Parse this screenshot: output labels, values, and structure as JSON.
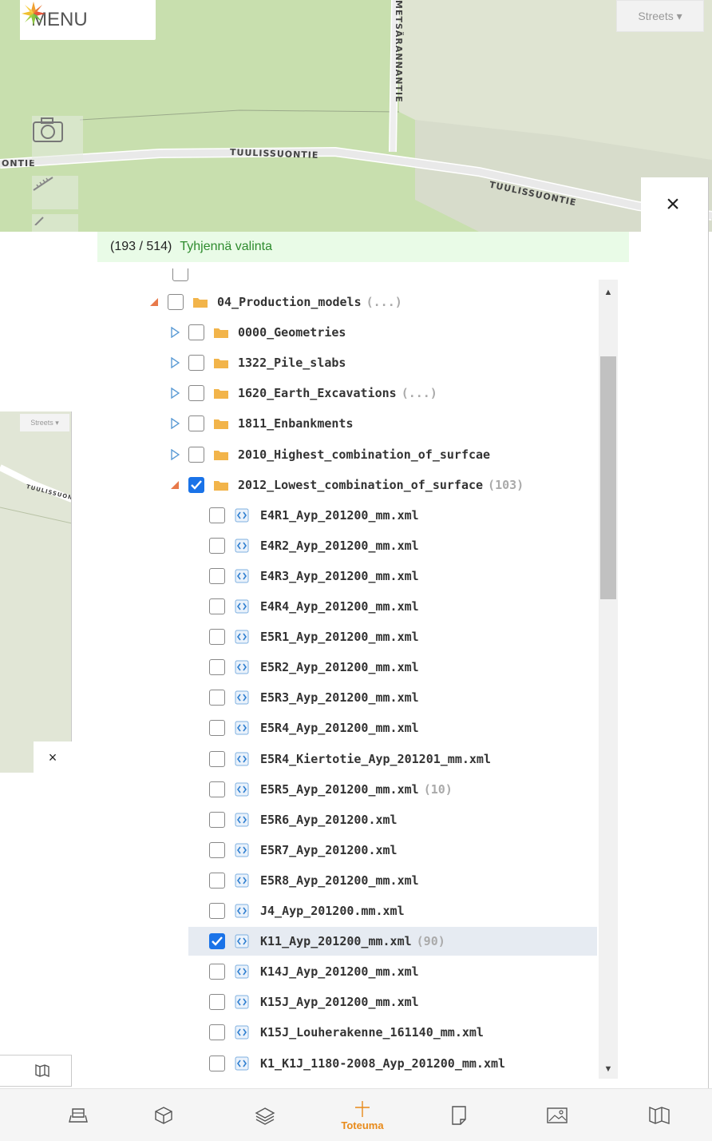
{
  "map": {
    "menu_label": "MENU",
    "basemap_label": "Streets ▾",
    "roads": {
      "vertical": "METSÄRANNANTIE",
      "main_1": "TUULISSUONTIE",
      "main_2": "TUULISSUONTIE",
      "left_fragment": "ONTIE"
    }
  },
  "ghost": {
    "basemap_label": "Streets ▾",
    "road_fragment": "TUULISSUONT",
    "close": "×"
  },
  "panel": {
    "close": "×",
    "selection_count": "(193 / 514)",
    "clear_selection": "Tyhjennä valinta"
  },
  "tree": [
    {
      "type": "folder",
      "depth": 0,
      "expanded": true,
      "checked": false,
      "label": "04_Production_models",
      "count": "(...)"
    },
    {
      "type": "folder",
      "depth": 1,
      "expanded": false,
      "checked": false,
      "label": "0000_Geometries",
      "count": ""
    },
    {
      "type": "folder",
      "depth": 1,
      "expanded": false,
      "checked": false,
      "label": "1322_Pile_slabs",
      "count": ""
    },
    {
      "type": "folder",
      "depth": 1,
      "expanded": false,
      "checked": false,
      "label": "1620_Earth_Excavations",
      "count": "(...)"
    },
    {
      "type": "folder",
      "depth": 1,
      "expanded": false,
      "checked": false,
      "label": "1811_Enbankments",
      "count": ""
    },
    {
      "type": "folder",
      "depth": 1,
      "expanded": false,
      "checked": false,
      "label": "2010_Highest_combination_of_surfcae",
      "count": ""
    },
    {
      "type": "folder",
      "depth": 1,
      "expanded": true,
      "checked": true,
      "label": "2012_Lowest_combination_of_surface",
      "count": "(103)"
    },
    {
      "type": "file",
      "depth": 2,
      "checked": false,
      "label": "E4R1_Ayp_201200_mm.xml",
      "count": ""
    },
    {
      "type": "file",
      "depth": 2,
      "checked": false,
      "label": "E4R2_Ayp_201200_mm.xml",
      "count": ""
    },
    {
      "type": "file",
      "depth": 2,
      "checked": false,
      "label": "E4R3_Ayp_201200_mm.xml",
      "count": ""
    },
    {
      "type": "file",
      "depth": 2,
      "checked": false,
      "label": "E4R4_Ayp_201200_mm.xml",
      "count": ""
    },
    {
      "type": "file",
      "depth": 2,
      "checked": false,
      "label": "E5R1_Ayp_201200_mm.xml",
      "count": ""
    },
    {
      "type": "file",
      "depth": 2,
      "checked": false,
      "label": "E5R2_Ayp_201200_mm.xml",
      "count": ""
    },
    {
      "type": "file",
      "depth": 2,
      "checked": false,
      "label": "E5R3_Ayp_201200_mm.xml",
      "count": ""
    },
    {
      "type": "file",
      "depth": 2,
      "checked": false,
      "label": "E5R4_Ayp_201200_mm.xml",
      "count": ""
    },
    {
      "type": "file",
      "depth": 2,
      "checked": false,
      "label": "E5R4_Kiertotie_Ayp_201201_mm.xml",
      "count": ""
    },
    {
      "type": "file",
      "depth": 2,
      "checked": false,
      "label": "E5R5_Ayp_201200_mm.xml",
      "count": "(10)"
    },
    {
      "type": "file",
      "depth": 2,
      "checked": false,
      "label": "E5R6_Ayp_201200.xml",
      "count": ""
    },
    {
      "type": "file",
      "depth": 2,
      "checked": false,
      "label": "E5R7_Ayp_201200.xml",
      "count": ""
    },
    {
      "type": "file",
      "depth": 2,
      "checked": false,
      "label": "E5R8_Ayp_201200_mm.xml",
      "count": ""
    },
    {
      "type": "file",
      "depth": 2,
      "checked": false,
      "label": "J4_Ayp_201200.mm.xml",
      "count": ""
    },
    {
      "type": "file",
      "depth": 2,
      "checked": true,
      "highlight": true,
      "label": "K11_Ayp_201200_mm.xml",
      "count": "(90)"
    },
    {
      "type": "file",
      "depth": 2,
      "checked": false,
      "label": "K14J_Ayp_201200_mm.xml",
      "count": ""
    },
    {
      "type": "file",
      "depth": 2,
      "checked": false,
      "label": "K15J_Ayp_201200_mm.xml",
      "count": ""
    },
    {
      "type": "file",
      "depth": 2,
      "checked": false,
      "label": "K15J_Louherakenne_161140_mm.xml",
      "count": ""
    },
    {
      "type": "file",
      "depth": 2,
      "checked": false,
      "label": "K1_K1J_1180-2008_Ayp_201200_mm.xml",
      "count": ""
    }
  ],
  "bottom_nav": [
    {
      "icon": "layers-map-icon",
      "label": ""
    },
    {
      "icon": "cube-icon",
      "label": ""
    },
    {
      "icon": "stack-layers-icon",
      "label": ""
    },
    {
      "icon": "plus-cross-icon",
      "label": "Toteuma",
      "active": true
    },
    {
      "icon": "note-icon",
      "label": ""
    },
    {
      "icon": "image-icon",
      "label": ""
    },
    {
      "icon": "map-panels-icon",
      "label": ""
    }
  ],
  "colors": {
    "checkbox_checked": "#1a73e8",
    "folder": "#f2b44a",
    "expand_open": "#e8794a",
    "expand_closed": "#5b9bd5",
    "active_nav": "#e88a1a",
    "selection_bar": "#e9fbe7",
    "clear_link": "#2e8b2e"
  }
}
